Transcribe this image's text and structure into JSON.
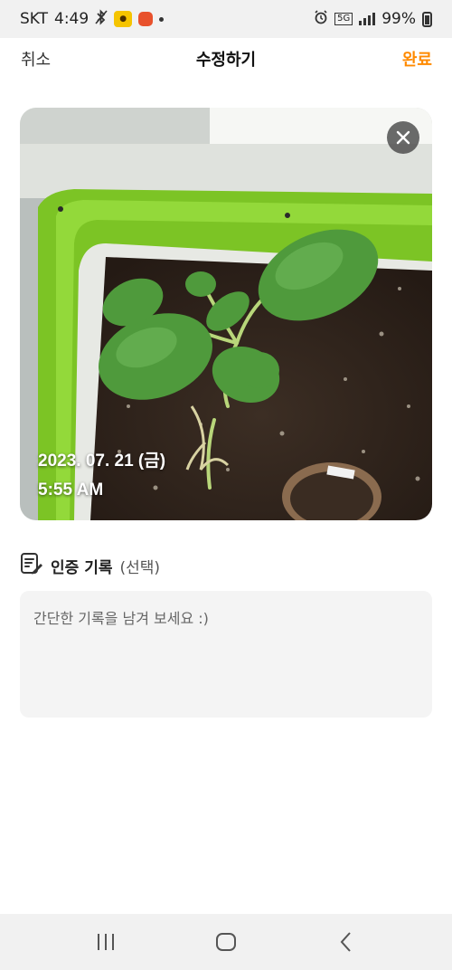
{
  "status_bar": {
    "carrier": "SKT",
    "time": "4:49",
    "network": "5G",
    "battery": "99%",
    "icons": [
      "bluetooth-off-icon",
      "kakao-app-icon",
      "red-app-icon",
      "notification-dot-icon",
      "alarm-icon",
      "5g-icon",
      "signal-icon",
      "battery-charging-icon"
    ]
  },
  "header": {
    "cancel_label": "취소",
    "title": "수정하기",
    "done_label": "완료"
  },
  "colors": {
    "accent": "#ff8a00",
    "memo_bg": "#f4f4f4"
  },
  "photo": {
    "date": "2023. 07. 21 (금)",
    "time": "5:55 AM",
    "close_icon": "close-icon"
  },
  "record": {
    "label_main": "인증 기록",
    "label_optional": "(선택)",
    "icon": "edit-note-icon",
    "placeholder": "간단한 기록을 남겨 보세요 :)"
  },
  "nav": {
    "icons": [
      "recent-apps-icon",
      "home-icon",
      "back-icon"
    ]
  }
}
